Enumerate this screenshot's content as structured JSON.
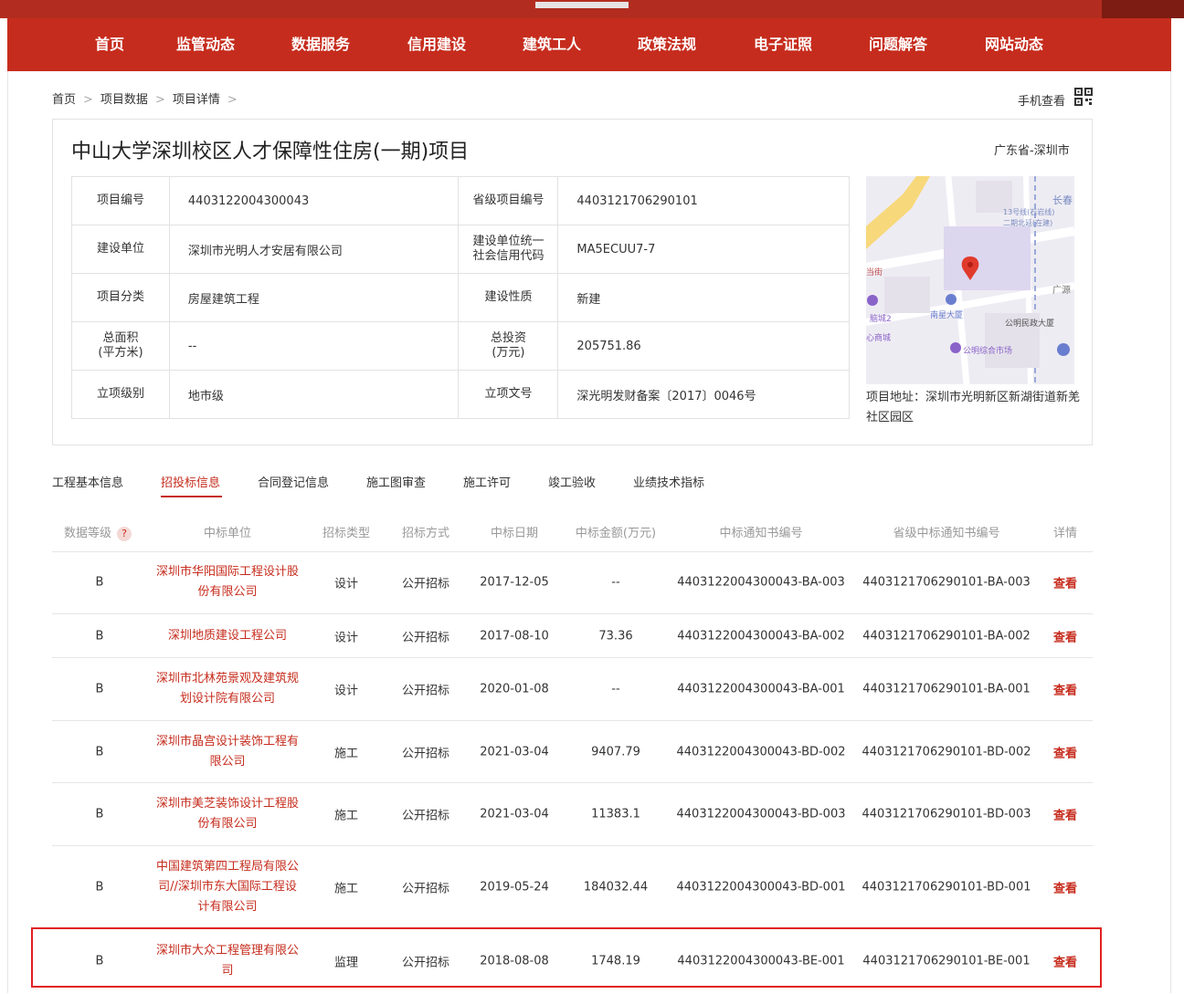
{
  "nav": {
    "items": [
      "首页",
      "监管动态",
      "数据服务",
      "信用建设",
      "建筑工人",
      "政策法规",
      "电子证照",
      "问题解答",
      "网站动态"
    ]
  },
  "breadcrumb": [
    "首页",
    "项目数据",
    "项目详情"
  ],
  "mobile_view": "手机查看",
  "project": {
    "title": "中山大学深圳校区人才保障性住房(一期)项目",
    "region": "广东省-深圳市",
    "fields": [
      {
        "l1": "项目编号",
        "v1": "4403122004300043",
        "l2": "省级项目编号",
        "v2": "4403121706290101"
      },
      {
        "l1": "建设单位",
        "v1": "深圳市光明人才安居有限公司",
        "l2": "建设单位统一社会信用代码",
        "v2": "MA5ECUU7-7"
      },
      {
        "l1": "项目分类",
        "v1": "房屋建筑工程",
        "l2": "建设性质",
        "v2": "新建"
      },
      {
        "l1": "总面积(平方米)",
        "v1": "--",
        "l2": "总投资(万元)",
        "v2": "205751.86"
      },
      {
        "l1": "立项级别",
        "v1": "地市级",
        "l2": "立项文号",
        "v2": "深光明发财备案〔2017〕0046号"
      }
    ],
    "address": "项目地址：深圳市光明新区新湖街道新羌社区园区",
    "map_labels": [
      "长春",
      "13号线(石岩线)",
      "二期北延(在建)",
      "当街",
      "广源",
      "脑城2",
      "南星大厦",
      "公明民政大厦",
      "心商城",
      "公明综合市场"
    ]
  },
  "tabs": [
    "工程基本信息",
    "招投标信息",
    "合同登记信息",
    "施工图审查",
    "施工许可",
    "竣工验收",
    "业绩技术指标"
  ],
  "active_tab": 1,
  "table": {
    "headers": [
      "数据等级",
      "中标单位",
      "招标类型",
      "招标方式",
      "中标日期",
      "中标金额(万元)",
      "中标通知书编号",
      "省级中标通知书编号",
      "详情"
    ],
    "help": "?",
    "rows": [
      {
        "grade": "B",
        "unit": "深圳市华阳国际工程设计股份有限公司",
        "type": "设计",
        "method": "公开招标",
        "date": "2017-12-05",
        "amount": "--",
        "no": "4403122004300043-BA-003",
        "pno": "4403121706290101-BA-003",
        "view": "查看"
      },
      {
        "grade": "B",
        "unit": "深圳地质建设工程公司",
        "type": "设计",
        "method": "公开招标",
        "date": "2017-08-10",
        "amount": "73.36",
        "no": "4403122004300043-BA-002",
        "pno": "4403121706290101-BA-002",
        "view": "查看"
      },
      {
        "grade": "B",
        "unit": "深圳市北林苑景观及建筑规划设计院有限公司",
        "type": "设计",
        "method": "公开招标",
        "date": "2020-01-08",
        "amount": "--",
        "no": "4403122004300043-BA-001",
        "pno": "4403121706290101-BA-001",
        "view": "查看"
      },
      {
        "grade": "B",
        "unit": "深圳市晶宫设计装饰工程有限公司",
        "type": "施工",
        "method": "公开招标",
        "date": "2021-03-04",
        "amount": "9407.79",
        "no": "4403122004300043-BD-002",
        "pno": "4403121706290101-BD-002",
        "view": "查看"
      },
      {
        "grade": "B",
        "unit": "深圳市美芝装饰设计工程股份有限公司",
        "type": "施工",
        "method": "公开招标",
        "date": "2021-03-04",
        "amount": "11383.1",
        "no": "4403122004300043-BD-003",
        "pno": "4403121706290101-BD-003",
        "view": "查看"
      },
      {
        "grade": "B",
        "unit": "中国建筑第四工程局有限公司//深圳市东大国际工程设计有限公司",
        "type": "施工",
        "method": "公开招标",
        "date": "2019-05-24",
        "amount": "184032.44",
        "no": "4403122004300043-BD-001",
        "pno": "4403121706290101-BD-001",
        "view": "查看"
      },
      {
        "grade": "B",
        "unit": "深圳市大众工程管理有限公司",
        "type": "监理",
        "method": "公开招标",
        "date": "2018-08-08",
        "amount": "1748.19",
        "no": "4403122004300043-BE-001",
        "pno": "4403121706290101-BE-001",
        "view": "查看"
      }
    ]
  },
  "colors": {
    "brand_red": "#c62c1d",
    "highlight_border": "#e02020"
  }
}
